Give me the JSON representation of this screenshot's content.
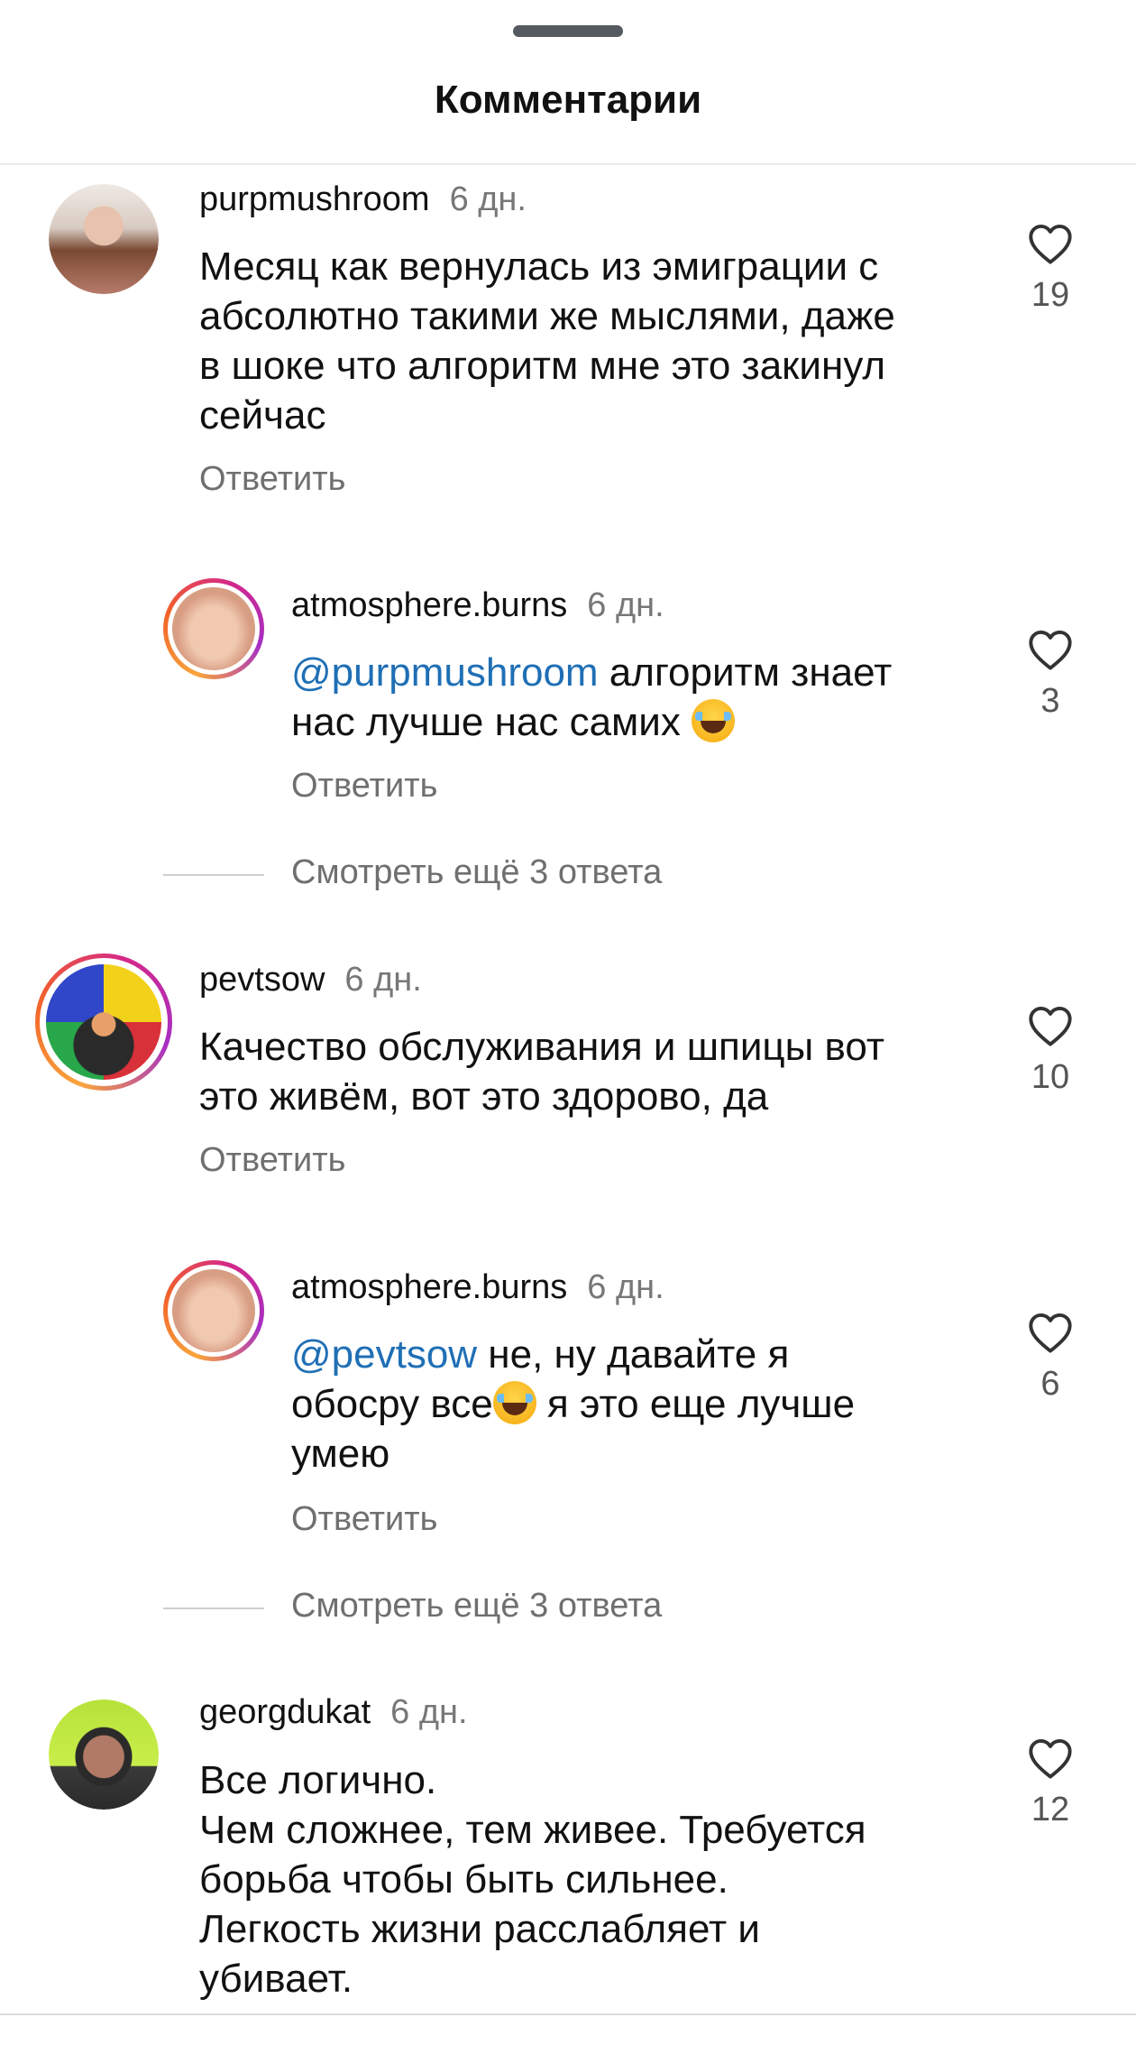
{
  "header": {
    "title": "Комментарии"
  },
  "comments": [
    {
      "username": "purpmushroom",
      "time": "6 дн.",
      "text": "Месяц как вернулась из эмиграции с\nабсолютно такими же мыслями, даже\nв шоке что алгоритм мне это закинул\nсейчас",
      "reply_label": "Ответить",
      "likes": "19",
      "replies": [
        {
          "username": "atmosphere.burns",
          "time": "6 дн.",
          "mention": "@purpmushroom",
          "text_line1": " алгоритм знает",
          "text_line2": "нас лучше нас самих ",
          "reply_label": "Ответить",
          "likes": "3"
        }
      ],
      "view_more": "Смотреть ещё 3 ответа"
    },
    {
      "username": "pevtsow",
      "time": "6 дн.",
      "text": "Качество обслуживания и шпицы вот\nэто живём, вот это здорово, да",
      "reply_label": "Ответить",
      "likes": "10",
      "replies": [
        {
          "username": "atmosphere.burns",
          "time": "6 дн.",
          "mention": "@pevtsow",
          "text_line1": " не, ну давайте я",
          "text_line2a": "обосру все",
          "text_line2b": " я это еще лучше",
          "text_line3": "умею",
          "reply_label": "Ответить",
          "likes": "6"
        }
      ],
      "view_more": "Смотреть ещё 3 ответа"
    },
    {
      "username": "georgdukat",
      "time": "6 дн.",
      "text": "Все логично.\nЧем сложнее, тем живее. Требуется\nборьба чтобы быть сильнее.\nЛегкость жизни расслабляет и\nубивает.",
      "likes": "12"
    }
  ],
  "icons": {
    "like": "heart-outline-icon",
    "emoji": "face-with-tears-of-joy-emoji"
  },
  "colors": {
    "mention": "#1f6fb5",
    "secondary_text": "#6f6f6f",
    "story_ring": [
      "#f9a53c",
      "#d4288a",
      "#a62fc4"
    ]
  }
}
